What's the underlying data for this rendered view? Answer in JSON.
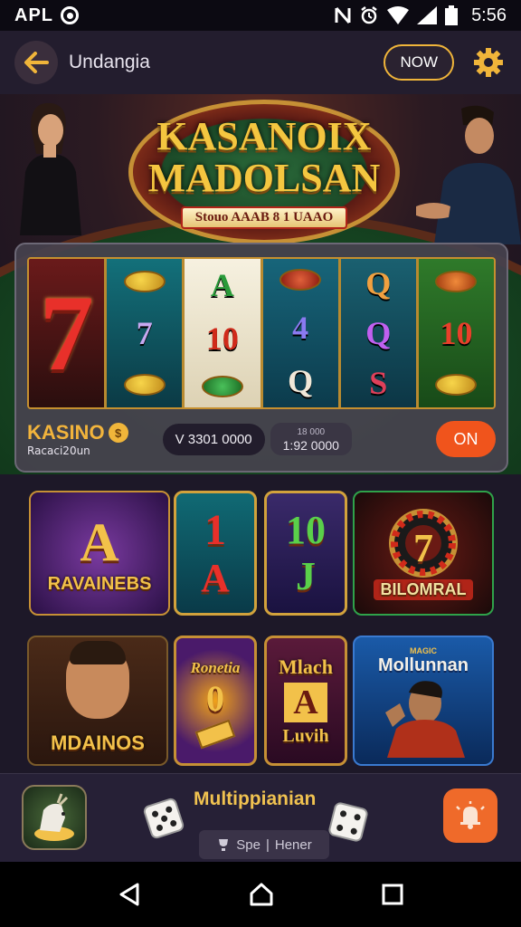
{
  "status_bar": {
    "carrier": "APL",
    "time": "5:56",
    "icons": [
      "nfc-icon",
      "alarm-icon",
      "wifi-icon",
      "signal-icon",
      "battery-icon"
    ]
  },
  "header": {
    "title": "Undangia",
    "now_button": "NOW",
    "back_icon": "arrow-left-icon",
    "settings_icon": "gear-icon"
  },
  "hero": {
    "logo_line1": "KASANOIX",
    "logo_line2": "MADOLSAN",
    "logo_ribbon": "Stouo AAAB 8 1 UAAO"
  },
  "slot": {
    "reels": [
      [
        "7"
      ],
      [
        "gem",
        "7",
        "gem"
      ],
      [
        "A",
        "10",
        "gem"
      ],
      [
        "gem",
        "4",
        "Q"
      ],
      [
        "Q",
        "Q",
        "S"
      ],
      [
        "gem",
        "10",
        "gem"
      ]
    ],
    "brand": "KASINO",
    "brand_sub": "Racaci20un",
    "balance": "V 3301 0000",
    "bet_label": "18 000",
    "bet_value": "1:92 0000",
    "spin_button": "ON"
  },
  "games": [
    {
      "label": "RAVAINEBS",
      "big": "A"
    },
    {
      "big": "1",
      "big2": "A"
    },
    {
      "big": "10",
      "big2": "J"
    },
    {
      "label": "BILOMRAL",
      "big": "7"
    },
    {
      "label": "MDAINOS"
    },
    {
      "label": "Ronetia",
      "big": "0"
    },
    {
      "label": "Mlach",
      "big": "A",
      "label2": "Luvih"
    },
    {
      "label": "Mollunnan",
      "tag": "MAGIC"
    }
  ],
  "dock": {
    "title": "Multippianian",
    "sub_left": "Spe",
    "sub_right": "Hener",
    "fab_icon": "bell-icon"
  },
  "nav": [
    "back-icon",
    "home-icon",
    "recents-icon"
  ],
  "colors": {
    "accent_gold": "#f0b53a",
    "spin_orange": "#f0541c",
    "fab_orange": "#ef6a2a",
    "background": "#1a1624"
  }
}
